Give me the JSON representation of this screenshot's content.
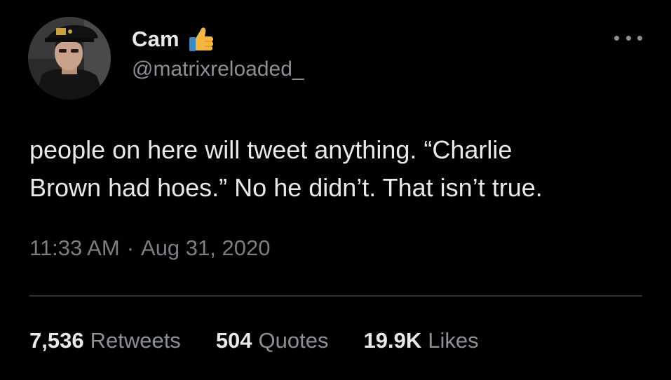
{
  "user": {
    "display_name": "Cam",
    "emoji": "thumbs-up-emoji",
    "handle": "@matrixreloaded_"
  },
  "tweet": {
    "text": "people on here will tweet anything. “Charlie\nBrown had hoes.” No he didn’t. That isn’t true.",
    "time": "11:33 AM",
    "separator": "·",
    "date": "Aug 31, 2020"
  },
  "stats": [
    {
      "value": "7,536",
      "label": "Retweets"
    },
    {
      "value": "504",
      "label": "Quotes"
    },
    {
      "value": "19.9K",
      "label": "Likes"
    }
  ],
  "colors": {
    "background": "#000000",
    "primary_text": "#e7e9ea",
    "secondary_text": "#8b9096",
    "divider": "#2f3336",
    "emoji_yellow": "#f4b63e"
  },
  "icons": {
    "more": "more-horizontal-icon"
  }
}
